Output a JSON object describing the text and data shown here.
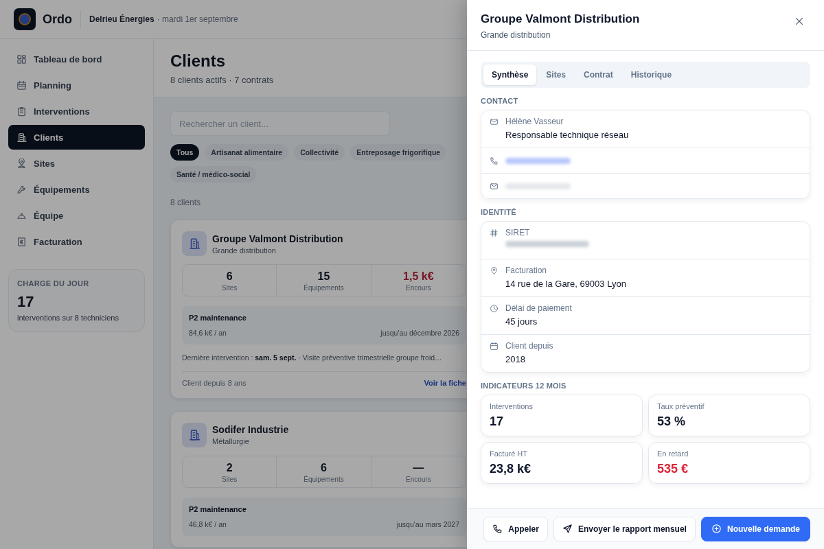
{
  "header": {
    "app_name": "Ordo",
    "company": "Delrieu Énergies",
    "date": "· mardi 1er septembre"
  },
  "sidebar": {
    "items": [
      {
        "label": "Tableau de bord",
        "selected": false
      },
      {
        "label": "Planning",
        "selected": false
      },
      {
        "label": "Interventions",
        "selected": false
      },
      {
        "label": "Clients",
        "selected": true
      },
      {
        "label": "Sites",
        "selected": false
      },
      {
        "label": "Équipements",
        "selected": false
      },
      {
        "label": "Équipe",
        "selected": false
      },
      {
        "label": "Facturation",
        "selected": false
      }
    ],
    "load_card": {
      "title": "CHARGE DU JOUR",
      "value": "17",
      "caption": "interventions sur 8 techniciens"
    }
  },
  "page": {
    "title": "Clients",
    "subtitle": "8 clients actifs · 7 contrats",
    "search": {
      "placeholder": "Rechercher un client..."
    },
    "filters": [
      {
        "label": "Tous",
        "selected": true
      },
      {
        "label": "Artisanat alimentaire",
        "selected": false
      },
      {
        "label": "Collectivité",
        "selected": false
      },
      {
        "label": "Entreposage frigorifique",
        "selected": false
      },
      {
        "label": "Santé / médico-social",
        "selected": false
      }
    ],
    "count": "8 clients",
    "clients": [
      {
        "name": "Groupe Valmont Distribution",
        "sector": "Grande distribution",
        "stats": [
          {
            "value": "6",
            "label": "Sites",
            "alert": false
          },
          {
            "value": "15",
            "label": "Équipements",
            "alert": false
          },
          {
            "value": "1,5 k€",
            "label": "Encours",
            "alert": true
          }
        ],
        "contract": {
          "name": "P2 maintenance",
          "amount": "84,6 k€ / an",
          "until": "jusqu'au décembre 2026"
        },
        "last_intervention": "Dernière intervention : **sam. 5 sept.** · Visite préventive trimestrielle groupe froid…",
        "since": "Client depuis 8 ans",
        "link": "Voir la fiche"
      },
      {
        "name": "Sodifer Industrie",
        "sector": "Métallurgie",
        "stats": [
          {
            "value": "2",
            "label": "Sites",
            "alert": false
          },
          {
            "value": "6",
            "label": "Équipements",
            "alert": false
          },
          {
            "value": "—",
            "label": "Encours",
            "alert": false
          }
        ],
        "contract": {
          "name": "P2 maintenance",
          "amount": "46,8 k€ / an",
          "until": "jusqu'au mars 2027"
        }
      }
    ]
  },
  "drawer": {
    "title": "Groupe Valmont Distribution",
    "subtitle": "Grande distribution",
    "tabs": [
      {
        "label": "Synthèse",
        "selected": true
      },
      {
        "label": "Sites",
        "selected": false
      },
      {
        "label": "Contrat",
        "selected": false
      },
      {
        "label": "Historique",
        "selected": false
      }
    ],
    "sections": [
      {
        "heading": "CONTACT",
        "rows": [
          {
            "kind": "person",
            "label": "Hélène Vasseur",
            "value": "Responsable technique réseau"
          },
          {
            "kind": "phone",
            "redacted": true
          },
          {
            "kind": "email",
            "redacted": true
          }
        ]
      },
      {
        "heading": "IDENTITÉ",
        "rows": [
          {
            "kind": "id",
            "label": "SIRET",
            "redacted": true
          },
          {
            "kind": "address",
            "label": "Facturation",
            "value": "14 rue de la Gare, 69003 Lyon"
          },
          {
            "kind": "delay",
            "label": "Délai de paiement",
            "value": "45 jours"
          },
          {
            "kind": "since",
            "label": "Client depuis",
            "value": "2018"
          }
        ]
      }
    ],
    "indicators_heading": "INDICATEURS 12 MOIS",
    "indicators": [
      {
        "label": "Interventions",
        "value": "17",
        "alert": false
      },
      {
        "label": "Taux préventif",
        "value": "53 %",
        "alert": false
      },
      {
        "label": "Facturé HT",
        "value": "23,8 k€",
        "alert": false
      },
      {
        "label": "En retard",
        "value": "535 €",
        "alert": true
      }
    ],
    "actions": [
      {
        "label": "Appeler",
        "kind": "call"
      },
      {
        "label": "Envoyer le rapport mensuel",
        "kind": "send"
      },
      {
        "label": "Nouvelle demande",
        "kind": "primary"
      }
    ]
  }
}
